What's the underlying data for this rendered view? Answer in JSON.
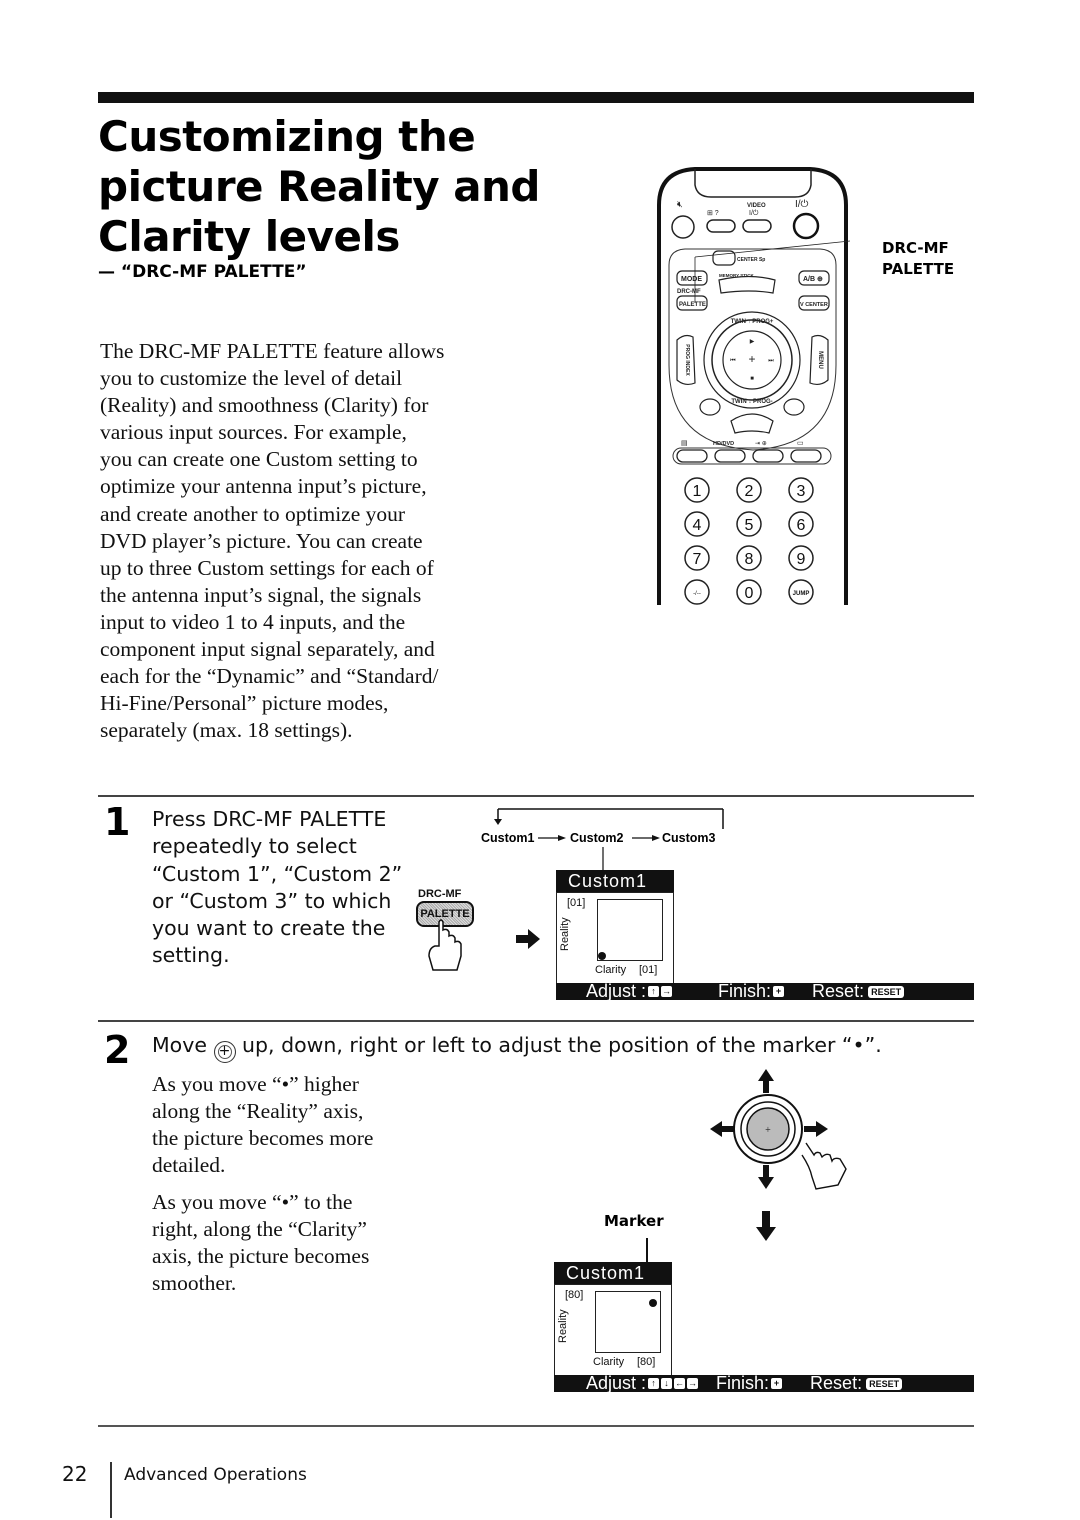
{
  "page": {
    "title_lines": [
      "Customizing the",
      "picture Reality and",
      "Clarity levels"
    ],
    "subtitle": "— “DRC-MF PALETTE”",
    "intro_lines": [
      "The DRC-MF PALETTE feature allows",
      "you to customize the level of detail",
      "(Reality) and smoothness (Clarity) for",
      "various input sources.  For example,",
      "you can create one Custom setting to",
      "optimize your antenna input’s picture,",
      "and create another to optimize your",
      "DVD player’s picture.  You can create",
      "up to three Custom settings for each of",
      "the antenna input’s signal, the signals",
      "input to video 1 to 4 inputs, and the",
      "component input signal separately, and",
      "each for the “Dynamic” and “Standard/",
      "Hi-Fine/Personal” picture modes,",
      "separately (max. 18 settings)."
    ]
  },
  "remote": {
    "callout_lines": [
      "DRC-MF",
      "PALETTE"
    ],
    "top_labels": {
      "mute": "×",
      "video": "VIDEO",
      "video_power": "I/⏻",
      "power": "I/⏻"
    },
    "buttons": {
      "center": "CENTER Sp",
      "mode": "MODE",
      "drc_mf": "DRC-MF",
      "palette": "PALETTE",
      "memory_stick": "MEMORY STICK",
      "ab": "A/B",
      "v_center": "V CENTER",
      "twin_prog_top": "TWIN ↑ PROG+",
      "twin_prog_bottom": "TWIN ↓ PROG-",
      "prog_index": "PROG INDEX",
      "menu": "MENU",
      "hd_dvd": "HD/DVD"
    },
    "numpad": [
      "1",
      "2",
      "3",
      "4",
      "5",
      "6",
      "7",
      "8",
      "9",
      "-/--",
      "0",
      "JUMP"
    ]
  },
  "step1": {
    "number": "1",
    "lines": [
      "Press DRC-MF PALETTE",
      "repeatedly to select",
      "“Custom 1”, “Custom 2”",
      "or “Custom 3” to which",
      "you want to create the",
      "setting."
    ],
    "button_label_top": "DRC-MF",
    "button_label": "PALETTE",
    "flow": [
      "Custom1",
      "Custom2",
      "Custom3"
    ],
    "osd": {
      "title": "Custom1",
      "reality_value": "[01]",
      "reality_label": "Reality",
      "clarity_label": "Clarity",
      "clarity_value": "[01]",
      "reality_level": 1,
      "clarity_level": 1,
      "adjust_label": "Adjust :",
      "finish_label": "Finish:",
      "reset_label": "Reset:",
      "reset_key": "RESET"
    }
  },
  "step2": {
    "number": "2",
    "head_before": "Move",
    "head_after": "up, down, right or left to adjust the position of the marker “•”.",
    "para1_lines": [
      "As you move “•” higher",
      "along the “Reality” axis,",
      "the picture becomes more",
      "detailed."
    ],
    "para2_lines": [
      "As you move “•” to the",
      "right, along the “Clarity”",
      "axis, the picture becomes",
      "smoother."
    ],
    "marker_label": "Marker",
    "osd": {
      "title": "Custom1",
      "reality_value": "[80]",
      "reality_label": "Reality",
      "clarity_label": "Clarity",
      "clarity_value": "[80]",
      "reality_level": 80,
      "clarity_level": 80,
      "adjust_label": "Adjust :",
      "finish_label": "Finish:",
      "reset_label": "Reset:",
      "reset_key": "RESET"
    }
  },
  "footer": {
    "page_number": "22",
    "section": "Advanced Operations"
  }
}
